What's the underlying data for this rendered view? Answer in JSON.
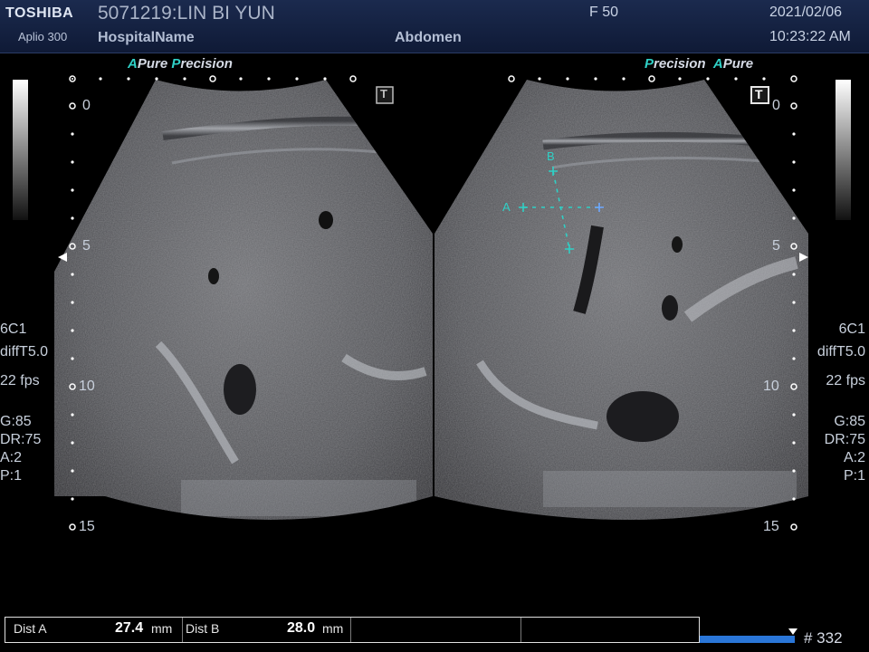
{
  "header": {
    "brand": "TOSHIBA",
    "model": "Aplio 300",
    "patient": "5071219:LIN BI YUN",
    "hospital": "HospitalName",
    "frame_rate_label": "F  50",
    "preset": "Abdomen",
    "date": "2021/02/06",
    "time": "10:23:22 AM"
  },
  "left_panel": {
    "logo_a": "A",
    "logo_pure": "Pure",
    "logo_p": "P",
    "logo_precision": "recision",
    "mode_icon": "T",
    "depth_labels": [
      "0",
      "5",
      "10",
      "15"
    ]
  },
  "right_panel": {
    "logo_p": "P",
    "logo_precision": "recision",
    "logo_a": "A",
    "logo_pure": "Pure",
    "mode_icon": "T",
    "depth_labels": [
      "0",
      "5",
      "10",
      "15"
    ]
  },
  "params_left": [
    "6C1",
    "diffT5.0",
    "22 fps",
    "G:85",
    "DR:75",
    "A:2",
    "P:1"
  ],
  "params_right": [
    "6C1",
    "diffT5.0",
    "22 fps",
    "G:85",
    "DR:75",
    "A:2",
    "P:1"
  ],
  "calipers": {
    "a": "A",
    "b": "B"
  },
  "measurements": {
    "dist_a_label": "Dist A",
    "dist_a_value": "27.4",
    "dist_a_unit": "mm",
    "dist_b_label": "Dist B",
    "dist_b_value": "28.0",
    "dist_b_unit": "mm"
  },
  "cine": {
    "frame_number": "# 332"
  },
  "colors": {
    "caliper": "#2fd0c6",
    "header_bg": "#1b2a4e",
    "cine_bar": "#2a76d8"
  }
}
